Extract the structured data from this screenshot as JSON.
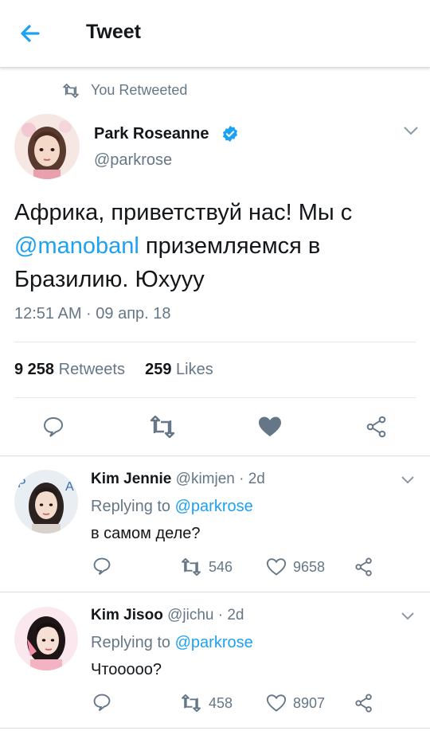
{
  "header": {
    "title": "Tweet"
  },
  "retweet_banner": "You Retweeted",
  "tweet": {
    "author_name": "Park Roseanne",
    "author_handle": "@parkrose",
    "text_part1": "Африка, приветствуй нас! Мы с",
    "mention": "@manobanl",
    "text_part2": " приземляемся в Бразилию. Юхууу",
    "timestamp": "12:51 AM · 09 апр. 18",
    "retweets_count": "9 258",
    "retweets_label": " Retweets",
    "likes_count": "259",
    "likes_label": " Likes"
  },
  "replies": [
    {
      "name": "Kim Jennie",
      "handle_time": " @kimjen · 2d",
      "replying_prefix": "Replying to ",
      "replying_to": "@parkrose",
      "text": "в самом деле?",
      "retweets": "546",
      "likes": "9658"
    },
    {
      "name": "Kim Jisoo",
      "handle_time": " @jichu · 2d",
      "replying_prefix": "Replying to ",
      "replying_to": "@parkrose",
      "text": "Чтооооо?",
      "retweets": "458",
      "likes": "8907"
    }
  ],
  "colors": {
    "accent": "#1da1f2",
    "secondary_text": "#657786",
    "primary_text": "#14171a"
  },
  "icons": [
    "back-arrow-icon",
    "retweet-icon",
    "verified-badge-icon",
    "chevron-down-icon",
    "reply-icon",
    "heart-icon",
    "share-icon"
  ]
}
